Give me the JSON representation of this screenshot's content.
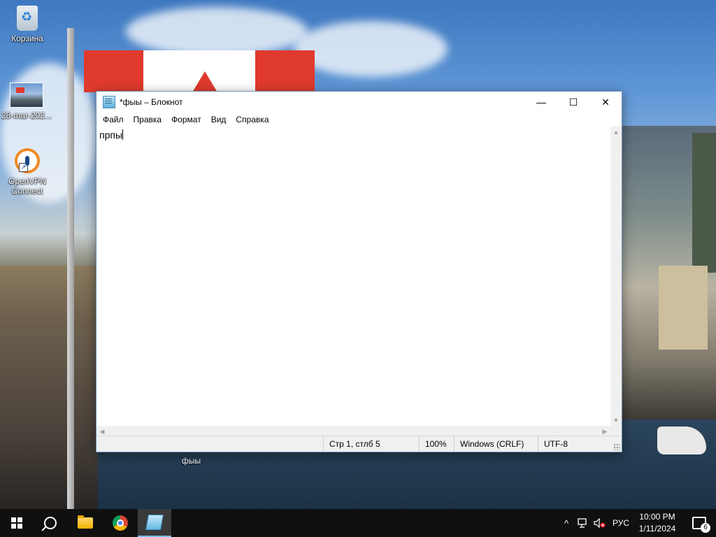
{
  "desktop": {
    "icons": [
      {
        "label": "Корзина",
        "icon": "recycle-bin-icon"
      },
      {
        "label": "28-mar-202...",
        "icon": "image-file-icon"
      },
      {
        "label": "OpenVPN Connect",
        "icon": "openvpn-icon"
      }
    ],
    "file_label": "фыы"
  },
  "notepad": {
    "title": "*фыы – Блокнот",
    "controls": {
      "minimize": "—",
      "maximize": "☐",
      "close": "✕"
    },
    "menu": [
      "Файл",
      "Правка",
      "Формат",
      "Вид",
      "Справка"
    ],
    "content": "прпы",
    "status": {
      "position": "Стр 1, стлб 5",
      "zoom": "100%",
      "line_endings": "Windows (CRLF)",
      "encoding": "UTF-8"
    }
  },
  "taskbar": {
    "pinned": [
      "start-icon",
      "search-icon",
      "file-explorer-icon",
      "chrome-icon",
      "notepad-icon"
    ],
    "tray": {
      "chevron": "^",
      "language": "РУС",
      "time": "10:00 PM",
      "date": "1/11/2024",
      "notifications_count": "6"
    }
  },
  "colors": {
    "taskbar": "#101010",
    "active_indicator": "#76b9ed",
    "close_hover": "#e81123"
  }
}
